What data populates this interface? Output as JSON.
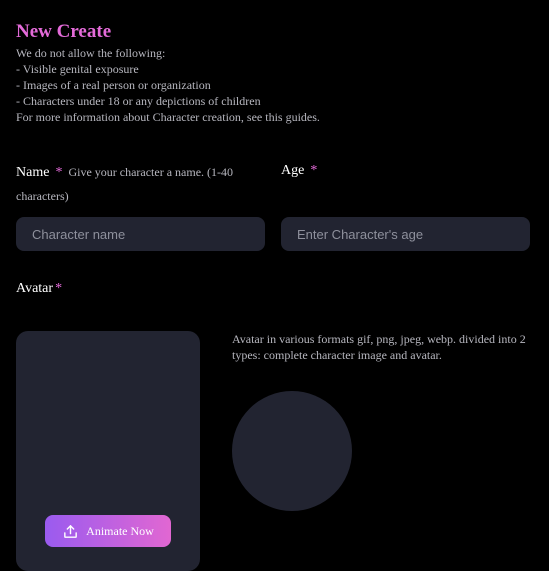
{
  "header": {
    "title": "New Create",
    "rules": [
      "We do not allow the following:",
      "- Visible genital exposure",
      "- Images of a real person or organization",
      "- Characters under 18 or any depictions of children",
      "For more information about Character creation, see this guides."
    ]
  },
  "form": {
    "name": {
      "label": "Name",
      "required_mark": "*",
      "hint": "Give your character a name. (1-40 characters)",
      "placeholder": "Character name",
      "value": ""
    },
    "age": {
      "label": "Age",
      "required_mark": "*",
      "placeholder": "Enter Character's age",
      "value": ""
    },
    "avatar": {
      "label": "Avatar",
      "required_mark": "*",
      "description": "Avatar in various formats gif, png, jpeg, webp. divided into 2 types: complete character image and avatar.",
      "animate_label": "Animate Now"
    }
  },
  "colors": {
    "accent": "#e46bd9",
    "background": "#000000",
    "field": "#222431",
    "button_gradient_start": "#9a5bef",
    "button_gradient_end": "#e167d2"
  },
  "icons": {
    "animate_button": "upload-icon"
  }
}
